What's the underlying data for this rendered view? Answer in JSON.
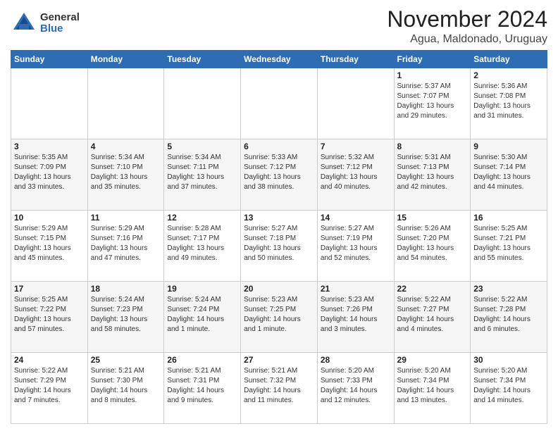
{
  "logo": {
    "general": "General",
    "blue": "Blue"
  },
  "header": {
    "title": "November 2024",
    "subtitle": "Agua, Maldonado, Uruguay"
  },
  "weekdays": [
    "Sunday",
    "Monday",
    "Tuesday",
    "Wednesday",
    "Thursday",
    "Friday",
    "Saturday"
  ],
  "weeks": [
    [
      {
        "day": "",
        "info": ""
      },
      {
        "day": "",
        "info": ""
      },
      {
        "day": "",
        "info": ""
      },
      {
        "day": "",
        "info": ""
      },
      {
        "day": "",
        "info": ""
      },
      {
        "day": "1",
        "info": "Sunrise: 5:37 AM\nSunset: 7:07 PM\nDaylight: 13 hours and 29 minutes."
      },
      {
        "day": "2",
        "info": "Sunrise: 5:36 AM\nSunset: 7:08 PM\nDaylight: 13 hours and 31 minutes."
      }
    ],
    [
      {
        "day": "3",
        "info": "Sunrise: 5:35 AM\nSunset: 7:09 PM\nDaylight: 13 hours and 33 minutes."
      },
      {
        "day": "4",
        "info": "Sunrise: 5:34 AM\nSunset: 7:10 PM\nDaylight: 13 hours and 35 minutes."
      },
      {
        "day": "5",
        "info": "Sunrise: 5:34 AM\nSunset: 7:11 PM\nDaylight: 13 hours and 37 minutes."
      },
      {
        "day": "6",
        "info": "Sunrise: 5:33 AM\nSunset: 7:12 PM\nDaylight: 13 hours and 38 minutes."
      },
      {
        "day": "7",
        "info": "Sunrise: 5:32 AM\nSunset: 7:12 PM\nDaylight: 13 hours and 40 minutes."
      },
      {
        "day": "8",
        "info": "Sunrise: 5:31 AM\nSunset: 7:13 PM\nDaylight: 13 hours and 42 minutes."
      },
      {
        "day": "9",
        "info": "Sunrise: 5:30 AM\nSunset: 7:14 PM\nDaylight: 13 hours and 44 minutes."
      }
    ],
    [
      {
        "day": "10",
        "info": "Sunrise: 5:29 AM\nSunset: 7:15 PM\nDaylight: 13 hours and 45 minutes."
      },
      {
        "day": "11",
        "info": "Sunrise: 5:29 AM\nSunset: 7:16 PM\nDaylight: 13 hours and 47 minutes."
      },
      {
        "day": "12",
        "info": "Sunrise: 5:28 AM\nSunset: 7:17 PM\nDaylight: 13 hours and 49 minutes."
      },
      {
        "day": "13",
        "info": "Sunrise: 5:27 AM\nSunset: 7:18 PM\nDaylight: 13 hours and 50 minutes."
      },
      {
        "day": "14",
        "info": "Sunrise: 5:27 AM\nSunset: 7:19 PM\nDaylight: 13 hours and 52 minutes."
      },
      {
        "day": "15",
        "info": "Sunrise: 5:26 AM\nSunset: 7:20 PM\nDaylight: 13 hours and 54 minutes."
      },
      {
        "day": "16",
        "info": "Sunrise: 5:25 AM\nSunset: 7:21 PM\nDaylight: 13 hours and 55 minutes."
      }
    ],
    [
      {
        "day": "17",
        "info": "Sunrise: 5:25 AM\nSunset: 7:22 PM\nDaylight: 13 hours and 57 minutes."
      },
      {
        "day": "18",
        "info": "Sunrise: 5:24 AM\nSunset: 7:23 PM\nDaylight: 13 hours and 58 minutes."
      },
      {
        "day": "19",
        "info": "Sunrise: 5:24 AM\nSunset: 7:24 PM\nDaylight: 14 hours and 1 minute."
      },
      {
        "day": "20",
        "info": "Sunrise: 5:23 AM\nSunset: 7:25 PM\nDaylight: 14 hours and 1 minute."
      },
      {
        "day": "21",
        "info": "Sunrise: 5:23 AM\nSunset: 7:26 PM\nDaylight: 14 hours and 3 minutes."
      },
      {
        "day": "22",
        "info": "Sunrise: 5:22 AM\nSunset: 7:27 PM\nDaylight: 14 hours and 4 minutes."
      },
      {
        "day": "23",
        "info": "Sunrise: 5:22 AM\nSunset: 7:28 PM\nDaylight: 14 hours and 6 minutes."
      }
    ],
    [
      {
        "day": "24",
        "info": "Sunrise: 5:22 AM\nSunset: 7:29 PM\nDaylight: 14 hours and 7 minutes."
      },
      {
        "day": "25",
        "info": "Sunrise: 5:21 AM\nSunset: 7:30 PM\nDaylight: 14 hours and 8 minutes."
      },
      {
        "day": "26",
        "info": "Sunrise: 5:21 AM\nSunset: 7:31 PM\nDaylight: 14 hours and 9 minutes."
      },
      {
        "day": "27",
        "info": "Sunrise: 5:21 AM\nSunset: 7:32 PM\nDaylight: 14 hours and 11 minutes."
      },
      {
        "day": "28",
        "info": "Sunrise: 5:20 AM\nSunset: 7:33 PM\nDaylight: 14 hours and 12 minutes."
      },
      {
        "day": "29",
        "info": "Sunrise: 5:20 AM\nSunset: 7:34 PM\nDaylight: 14 hours and 13 minutes."
      },
      {
        "day": "30",
        "info": "Sunrise: 5:20 AM\nSunset: 7:34 PM\nDaylight: 14 hours and 14 minutes."
      }
    ]
  ]
}
